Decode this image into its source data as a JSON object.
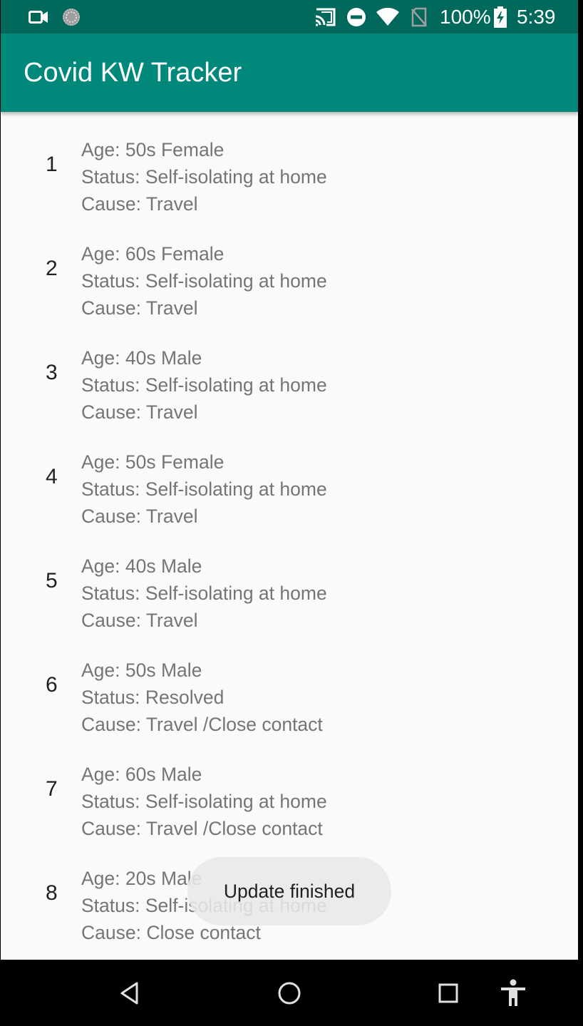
{
  "status_bar": {
    "battery": "100%",
    "time": "5:39",
    "icons": [
      "video-camera-icon",
      "loading-icon",
      "cast-icon",
      "do-not-disturb-icon",
      "wifi-icon",
      "no-sim-icon",
      "battery-charging-icon"
    ]
  },
  "app_bar": {
    "title": "Covid KW Tracker",
    "color": "#00897b",
    "status_color": "#00695c"
  },
  "cases": [
    {
      "number": "1",
      "age": "Age: 50s Female",
      "status": "Status: Self-isolating at home",
      "cause": "Cause: Travel"
    },
    {
      "number": "2",
      "age": "Age: 60s Female",
      "status": "Status: Self-isolating at home",
      "cause": "Cause: Travel"
    },
    {
      "number": "3",
      "age": "Age: 40s Male",
      "status": "Status: Self-isolating at home",
      "cause": "Cause: Travel"
    },
    {
      "number": "4",
      "age": "Age: 50s Female",
      "status": "Status: Self-isolating at home",
      "cause": "Cause: Travel"
    },
    {
      "number": "5",
      "age": "Age: 40s Male",
      "status": "Status: Self-isolating at home",
      "cause": "Cause: Travel"
    },
    {
      "number": "6",
      "age": "Age: 50s Male",
      "status": "Status: Resolved",
      "cause": "Cause: Travel /Close contact"
    },
    {
      "number": "7",
      "age": "Age: 60s Male",
      "status": "Status: Self-isolating at home",
      "cause": "Cause: Travel /Close contact"
    },
    {
      "number": "8",
      "age": "Age: 20s Male",
      "status": "Status: Self-isolating at home",
      "cause": "Cause: Close contact"
    }
  ],
  "toast": {
    "message": "Update finished"
  },
  "nav_bar": {
    "buttons": [
      "back-icon",
      "home-icon",
      "recents-icon",
      "accessibility-icon"
    ]
  }
}
